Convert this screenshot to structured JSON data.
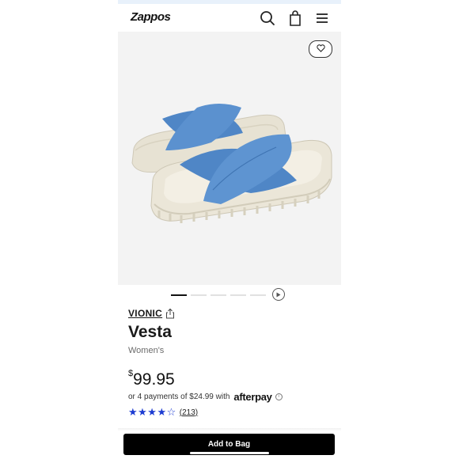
{
  "header": {
    "logo": "Zappos",
    "icons": [
      "search-icon",
      "cart-icon",
      "menu-icon"
    ]
  },
  "product_image": {
    "favorite_icon": "heart-icon",
    "image_subject": "blue cross-strap platform slide sandals",
    "strap_color": "#4f86c6",
    "sole_color": "#e7e2d3"
  },
  "carousel": {
    "dots": 5,
    "active_index": 0,
    "video_icon": "play-icon"
  },
  "product": {
    "brand": "VIONIC",
    "name": "Vesta",
    "gender": "Women's",
    "price_currency": "$",
    "price_amount": "99.95",
    "installments_text": "or 4 payments of $24.99 with",
    "installments_provider": "afterpay",
    "rating_stars": 4,
    "rating_max": 5,
    "rating_display": "★★★★☆",
    "review_count": "(213)"
  },
  "actions": {
    "add_to_bag": "Add to Bag"
  },
  "colors": {
    "accent_black": "#000000",
    "star_blue": "#1c3bd1",
    "top_strip": "#e8f1fb"
  }
}
